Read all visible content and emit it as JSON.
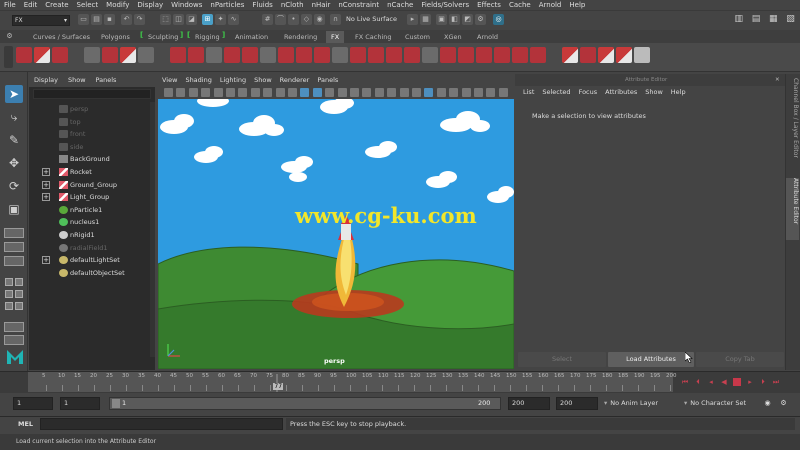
{
  "menubar": {
    "items": [
      "File",
      "Edit",
      "Create",
      "Select",
      "Modify",
      "Display",
      "Windows",
      "nParticles",
      "Fluids",
      "nCloth",
      "nHair",
      "nConstraint",
      "nCache",
      "Fields/Solvers",
      "Effects",
      "Cache",
      "Arnold",
      "Help"
    ]
  },
  "status_line": {
    "mode": "FX",
    "live_surface": "No Live Surface"
  },
  "shelf": {
    "tabs": [
      "Curves / Surfaces",
      "Polygons",
      "Sculpting",
      "Rigging",
      "Animation",
      "Rendering",
      "FX",
      "FX Caching",
      "Custom",
      "XGen",
      "Arnold"
    ],
    "active_tab": "FX"
  },
  "outliner": {
    "menu": [
      "Display",
      "Show",
      "Panels"
    ],
    "nodes": [
      {
        "label": "persp",
        "icon": "camera-icon",
        "dim": true,
        "expandable": false
      },
      {
        "label": "top",
        "icon": "camera-icon",
        "dim": true,
        "expandable": false
      },
      {
        "label": "front",
        "icon": "camera-icon",
        "dim": true,
        "expandable": false
      },
      {
        "label": "side",
        "icon": "camera-icon",
        "dim": true,
        "expandable": false
      },
      {
        "label": "BackGround",
        "icon": "mesh-icon",
        "dim": false,
        "expandable": false
      },
      {
        "label": "Rocket",
        "icon": "group-icon",
        "dim": false,
        "expandable": true
      },
      {
        "label": "Ground_Group",
        "icon": "group-icon",
        "dim": false,
        "expandable": true
      },
      {
        "label": "Light_Group",
        "icon": "group-icon",
        "dim": false,
        "expandable": true
      },
      {
        "label": "nParticle1",
        "icon": "nparticle-icon",
        "dim": false,
        "expandable": false
      },
      {
        "label": "nucleus1",
        "icon": "nucleus-icon",
        "dim": false,
        "expandable": false
      },
      {
        "label": "nRigid1",
        "icon": "nrigid-icon",
        "dim": false,
        "expandable": false
      },
      {
        "label": "radialField1",
        "icon": "field-icon",
        "dim": true,
        "expandable": false
      },
      {
        "label": "defaultLightSet",
        "icon": "set-icon",
        "dim": false,
        "expandable": true
      },
      {
        "label": "defaultObjectSet",
        "icon": "set-icon",
        "dim": false,
        "expandable": false
      }
    ]
  },
  "viewport": {
    "menu": [
      "View",
      "Shading",
      "Lighting",
      "Show",
      "Renderer",
      "Panels"
    ],
    "camera_label": "persp",
    "watermark": "www.cg-ku.com",
    "colors": {
      "sky": "#2e9be0",
      "hills": "#3f8a32",
      "flame": "#f5d04a",
      "scorch": "#b83a1e"
    }
  },
  "attribute_editor": {
    "title": "Attribute Editor",
    "menu": [
      "List",
      "Selected",
      "Focus",
      "Attributes",
      "Show",
      "Help"
    ],
    "message": "Make a selection to view attributes",
    "buttons": {
      "select": "Select",
      "load": "Load Attributes",
      "copy": "Copy Tab"
    },
    "side_tabs": [
      "Channel Box / Layer Editor",
      "Attribute Editor"
    ]
  },
  "time_slider": {
    "ticks": [
      5,
      10,
      15,
      20,
      25,
      30,
      35,
      40,
      45,
      50,
      55,
      60,
      65,
      70,
      75,
      80,
      85,
      90,
      95,
      100,
      105,
      110,
      115,
      120,
      125,
      130,
      135,
      140,
      145,
      150,
      155,
      160,
      165,
      170,
      175,
      180,
      185,
      190,
      195,
      200
    ],
    "current_frame": "77"
  },
  "range_slider": {
    "start": "1",
    "playback_start": "1",
    "range_start_knob": "1",
    "range_end": "200",
    "playback_end": "200",
    "end": "200",
    "anim_layer": "No Anim Layer",
    "character_set": "No Character Set"
  },
  "command_line": {
    "label": "MEL",
    "result": "Press the ESC key to stop playback."
  },
  "help_line": {
    "text": "Load current selection into the Attribute Editor"
  }
}
